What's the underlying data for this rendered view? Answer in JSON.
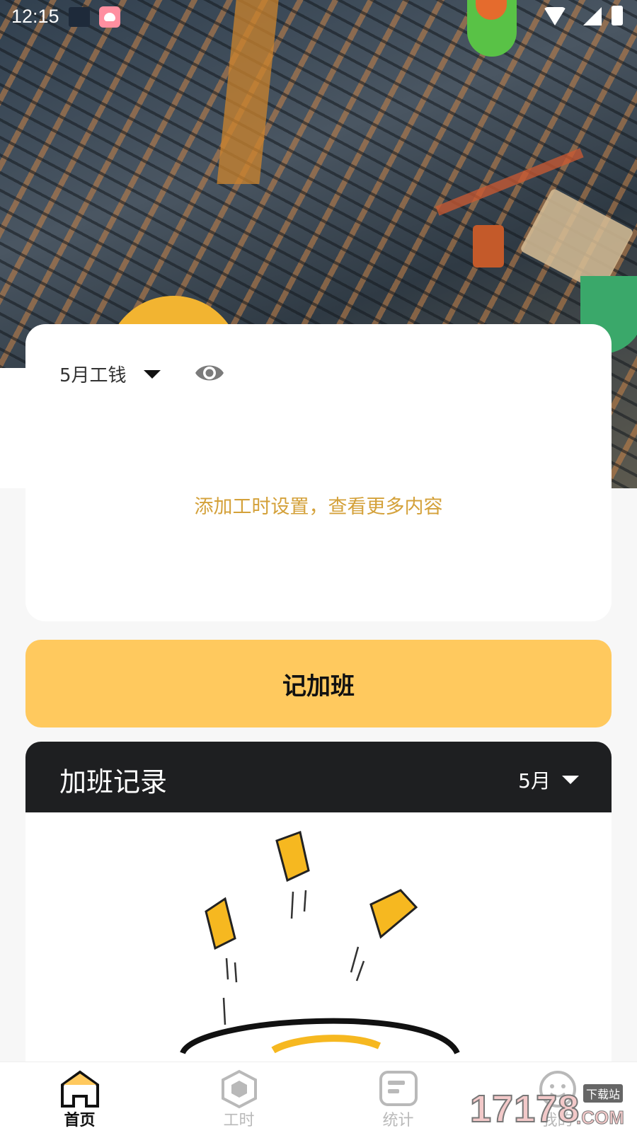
{
  "status_bar": {
    "time": "12:15",
    "icons": [
      "calendar-app-icon",
      "baby-app-icon",
      "wifi-icon",
      "signal-icon",
      "battery-icon"
    ]
  },
  "summary_card": {
    "month_label": "5月工钱",
    "hint": "添加工时设置，查看更多内容"
  },
  "primary_action": {
    "label": "记加班"
  },
  "records": {
    "title": "加班记录",
    "month_filter": "5月"
  },
  "tabbar": {
    "items": [
      {
        "label": "首页",
        "icon": "home-icon",
        "active": true
      },
      {
        "label": "工时",
        "icon": "hexagon-icon",
        "active": false
      },
      {
        "label": "统计",
        "icon": "stats-icon",
        "active": false
      },
      {
        "label": "我的",
        "icon": "smiley-icon",
        "active": false
      }
    ]
  },
  "watermark": {
    "text": "17178",
    "sub": "下载站",
    "domain": ".COM"
  },
  "colors": {
    "accent_yellow": "#ffc95e",
    "hint_gold": "#d4a13a",
    "dark_header": "#1e1f21"
  }
}
